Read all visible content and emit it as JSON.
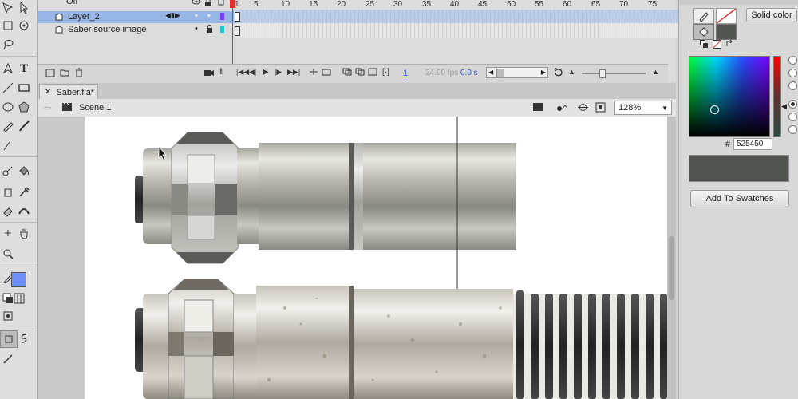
{
  "timeline": {
    "top_layer_label": "Off",
    "layers": [
      {
        "name": "Layer_2",
        "selected": true
      },
      {
        "name": "Saber source image",
        "selected": false
      }
    ],
    "ruler": [
      "1",
      "5",
      "10",
      "15",
      "20",
      "25",
      "30",
      "35",
      "40",
      "45",
      "50",
      "55",
      "60",
      "65",
      "70",
      "75"
    ],
    "playback": {
      "current_frame": "1",
      "fps": "24.00 fps",
      "time": "0.0 s"
    }
  },
  "document": {
    "tab_name": "Saber.fla*",
    "scene_name": "Scene 1",
    "zoom": "128%"
  },
  "color_panel": {
    "fill_type": "Solid color",
    "hex_label": "#",
    "hex_value": "525450",
    "add_swatches_label": "Add To Swatches",
    "current_color": "#525450"
  },
  "colors": {
    "selected_layer_bg": "#97b6e6",
    "playhead": "#e03030",
    "layer_outline": "#7a3cff",
    "fill_swatch": "#6f8ff8"
  }
}
